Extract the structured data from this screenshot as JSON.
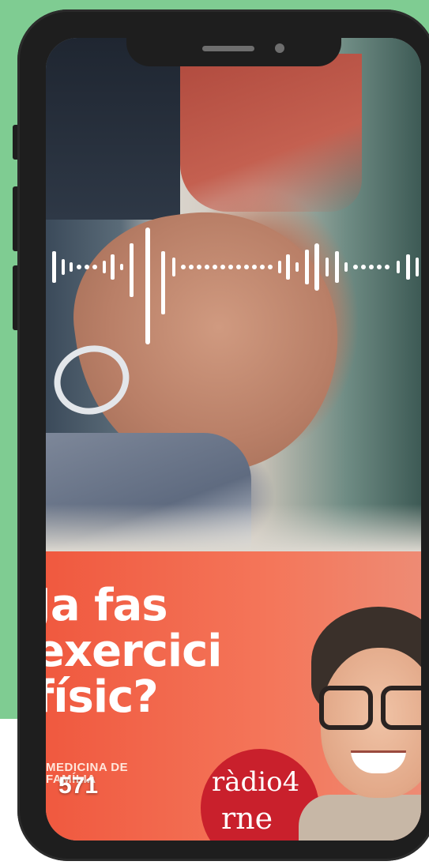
{
  "banner": {
    "headline_lines": [
      "Ja fas",
      "exercici",
      "físic?"
    ],
    "program_label": "MEDICINA DE FAMÍLIA",
    "view_count": "571",
    "logo_line1": "ràdio4",
    "logo_line2": "rne"
  },
  "colors": {
    "background": "#7fcc92",
    "banner": "#f0593f",
    "logo": "#c9202c"
  },
  "icons": [
    "audio-waveform-icon",
    "radio4-logo"
  ]
}
